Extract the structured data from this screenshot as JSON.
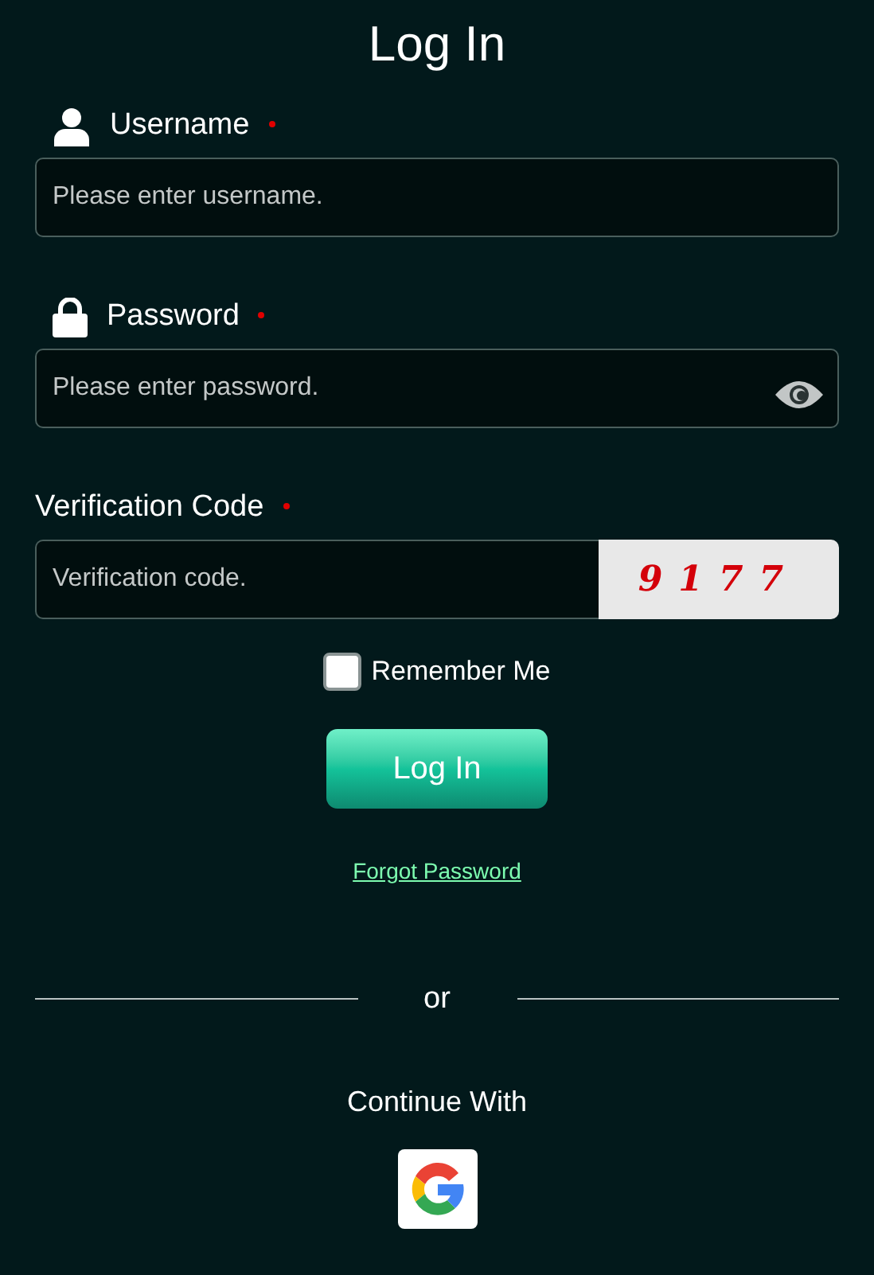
{
  "title": "Log In",
  "fields": [
    {
      "kind": "username",
      "label": "Username",
      "required": true,
      "placeholder": "Please enter username."
    },
    {
      "kind": "password",
      "label": "Password",
      "required": true,
      "placeholder": "Please enter password."
    },
    {
      "kind": "captcha",
      "label": "Verification Code",
      "required": true,
      "placeholder": "Verification code.",
      "captcha": "9177"
    }
  ],
  "remember": {
    "label": "Remember Me",
    "checked": false
  },
  "login_button": "Log In",
  "forgot_link": "Forgot Password",
  "divider": "or",
  "continue_with": "Continue With"
}
